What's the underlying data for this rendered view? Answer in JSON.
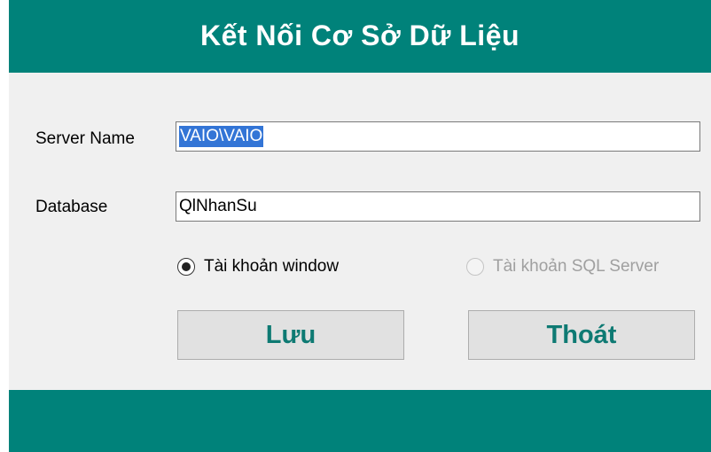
{
  "window": {
    "title": "Kết Nối Cơ Sở Dữ Liệu"
  },
  "form": {
    "server_name_label": "Server Name",
    "server_name_value": "VAIO\\VAIO",
    "database_label": "Database",
    "database_value": "QlNhanSu"
  },
  "auth": {
    "windows_label": "Tài khoản window",
    "windows_selected": true,
    "sql_label": "Tài khoản SQL Server",
    "sql_selected": false,
    "sql_enabled": false
  },
  "buttons": {
    "save_label": "Lưu",
    "exit_label": "Thoát"
  },
  "colors": {
    "accent": "#00827a",
    "button_text": "#0e7a73",
    "selection": "#3375d6"
  }
}
